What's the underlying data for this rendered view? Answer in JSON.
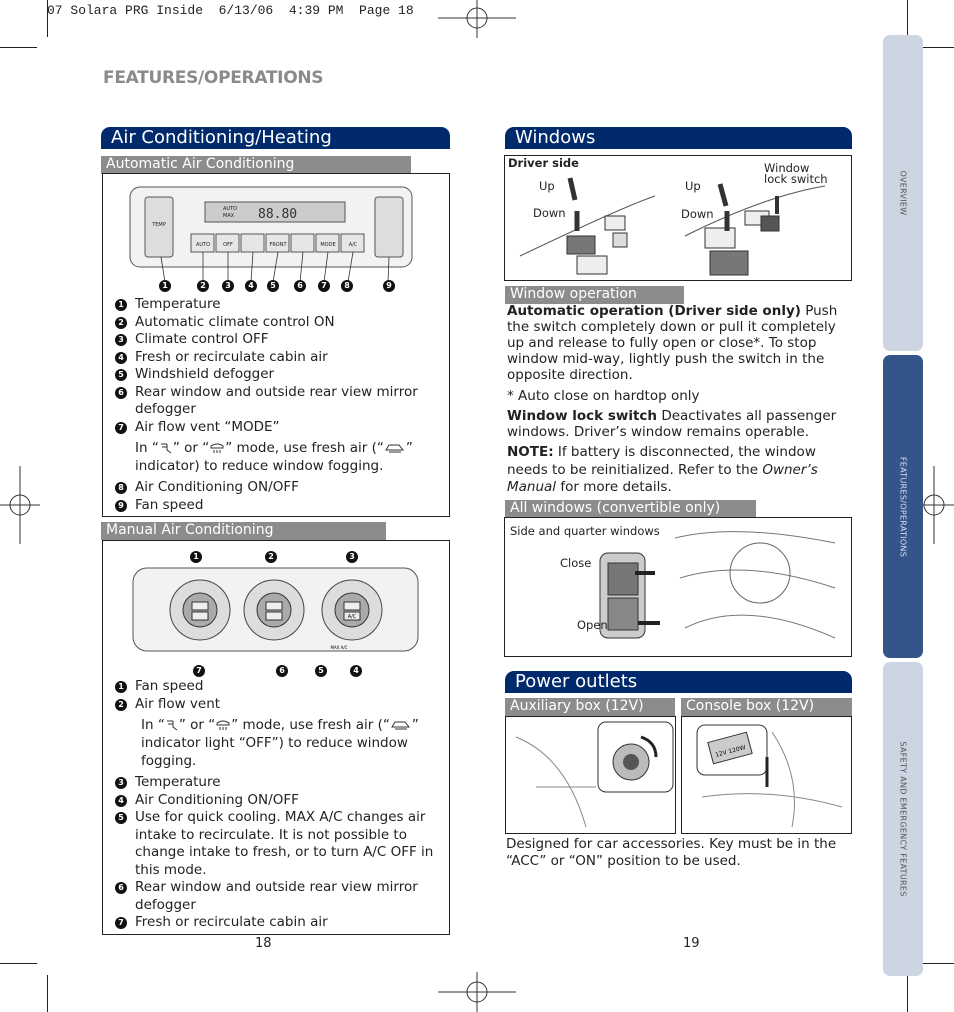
{
  "slug": "07 Solara PRG Inside  6/13/06  4:39 PM  Page 18",
  "section_title": "FEATURES/OPERATIONS",
  "side_tabs": [
    {
      "label": "OVERVIEW",
      "active": false
    },
    {
      "label": "FEATURES/OPERATIONS",
      "active": true
    },
    {
      "label": "SAFETY AND EMERGENCY FEATURES",
      "active": false
    }
  ],
  "colors": {
    "header_blue": "#002a6c",
    "subheader_gray": "#8c8c8c",
    "tab_active": "#33558a",
    "tab_inactive": "#cdd5e2"
  },
  "left": {
    "header": "Air Conditioning/Heating",
    "auto": {
      "subheader": "Automatic Air Conditioning",
      "panel_labels": {
        "temp": "TEMP",
        "auto": "AUTO",
        "off": "OFF",
        "front": "FRONT",
        "mode": "MODE",
        "ac": "A/C",
        "display_auto": "AUTO",
        "display_max": "MAX",
        "display_digits": "88.80"
      },
      "callouts": [
        "1",
        "2",
        "3",
        "4",
        "5",
        "6",
        "7",
        "8",
        "9"
      ],
      "items": [
        {
          "n": "1",
          "text": "Temperature"
        },
        {
          "n": "2",
          "text": "Automatic climate control ON"
        },
        {
          "n": "3",
          "text": "Climate control OFF"
        },
        {
          "n": "4",
          "text": "Fresh or recirculate cabin air"
        },
        {
          "n": "5",
          "text": "Windshield defogger"
        },
        {
          "n": "6",
          "text": "Rear window and outside rear view mirror defogger"
        },
        {
          "n": "7",
          "text": "Air flow vent “MODE”"
        },
        {
          "n": "8",
          "text": "Air Conditioning ON/OFF"
        },
        {
          "n": "9",
          "text": "Fan speed"
        }
      ],
      "note": {
        "p1": "In “",
        "p2": "” or “",
        "p3": "” mode, use fresh air (“",
        "p4": "” indicator) to reduce window fogging."
      }
    },
    "manual": {
      "subheader": "Manual Air Conditioning",
      "callouts_top": [
        "1",
        "2",
        "3"
      ],
      "callouts_bottom": [
        "7",
        "6",
        "5",
        "4"
      ],
      "dial_labels": {
        "ac": "A/C",
        "max": "MAX A/C"
      },
      "items": [
        {
          "n": "1",
          "text": "Fan speed"
        },
        {
          "n": "2",
          "text": "Air flow vent"
        },
        {
          "n": "3",
          "text": "Temperature"
        },
        {
          "n": "4",
          "text": "Air Conditioning ON/OFF"
        },
        {
          "n": "5",
          "text": "Use for quick cooling. MAX A/C changes air intake to recirculate. It is not possible to change intake to fresh, or to turn A/C OFF in this mode."
        },
        {
          "n": "6",
          "text": "Rear window and outside rear view mirror defogger"
        },
        {
          "n": "7",
          "text": "Fresh or recirculate cabin air"
        }
      ],
      "note": {
        "p1": "In “",
        "p2": "” or “",
        "p3": "” mode, use fresh air (“",
        "p4": "” indicator light “OFF”) to reduce window fogging."
      }
    },
    "page_number": "18"
  },
  "right": {
    "windows": {
      "header": "Windows",
      "figure": {
        "caption": "Driver side",
        "up1": "Up",
        "down1": "Down",
        "up2": "Up",
        "down2": "Down",
        "lock": "Window lock switch"
      },
      "operation_subheader": "Window operation",
      "auto_bold": "Automatic operation (Driver side only)",
      "auto_text": " Push the switch completely down or pull it completely up and release to fully open or close*. To stop window mid-way, lightly push the switch in the opposite direction.",
      "footnote": "* Auto close on hardtop only",
      "lock_bold": "Window lock switch",
      "lock_text": " Deactivates all passenger windows. Driver’s window remains operable.",
      "note_bold": "NOTE:",
      "note_text1": " If battery is disconnected, the window needs to be reinitialized. Refer to the ",
      "note_italic": "Owner’s Manual",
      "note_text2": " for more details.",
      "all_subheader": "All windows (convertible only)",
      "all_figure": {
        "caption": "Side and quarter windows",
        "close": "Close",
        "open": "Open"
      }
    },
    "power": {
      "header": "Power outlets",
      "aux_subheader": "Auxiliary box (12V)",
      "console_subheader": "Console box (12V)",
      "outlet_label": "12V 120W",
      "text": "Designed for car accessories. Key must be in the “ACC” or “ON” position to be used."
    },
    "page_number": "19"
  }
}
